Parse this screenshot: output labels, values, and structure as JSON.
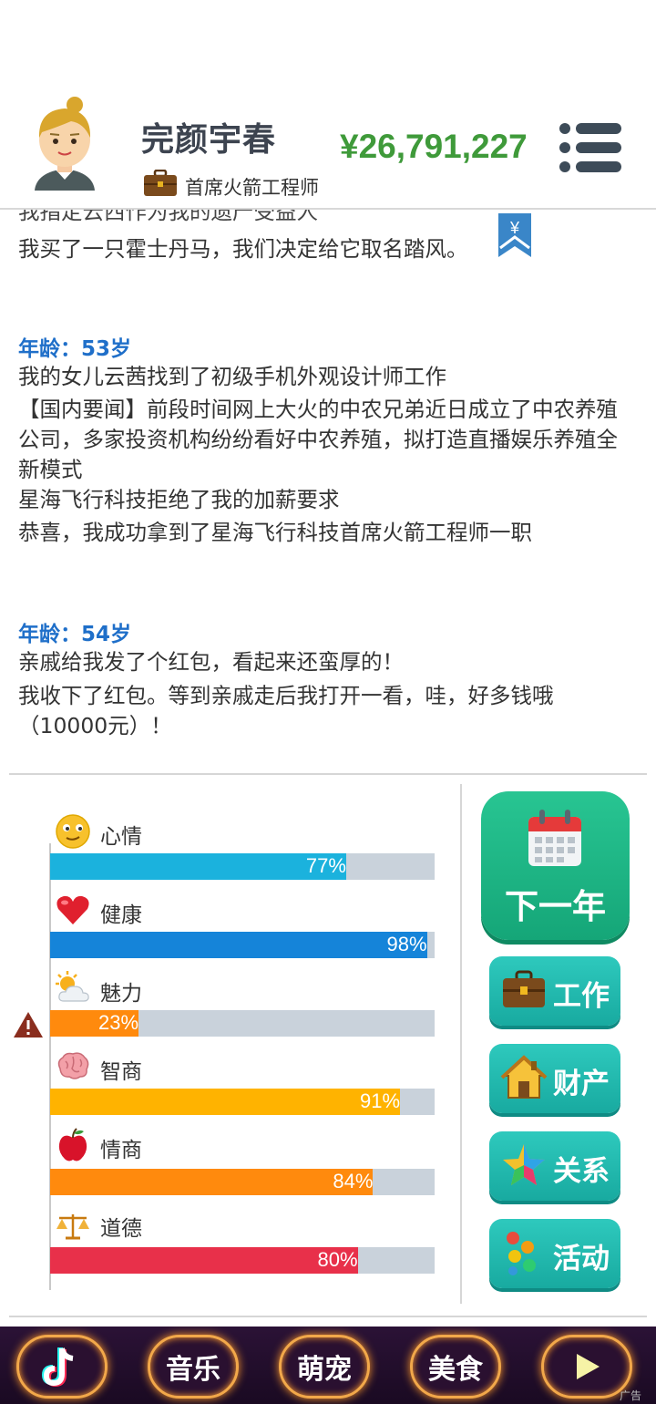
{
  "header": {
    "player_name": "完颜宇春",
    "job_title": "首席火箭工程师",
    "money": "¥26,791,227"
  },
  "log": {
    "partial_line": "我指定云西作为我的遗产受益人",
    "bookmark_symbol": "¥",
    "lines": [
      "我买了一只霍士丹马，我们决定给它取名踏风。"
    ],
    "age_53": "年龄：53岁",
    "entries_53": [
      "我的女儿云茜找到了初级手机外观设计师工作",
      "【国内要闻】前段时间网上大火的中农兄弟近日成立了中农养殖公司，多家投资机构纷纷看好中农养殖，拟打造直播娱乐养殖全新模式",
      "星海飞行科技拒绝了我的加薪要求",
      "恭喜，我成功拿到了星海飞行科技首席火箭工程师一职"
    ],
    "age_54": "年龄：54岁",
    "entries_54": [
      "亲戚给我发了个红包，看起来还蛮厚的！",
      "我收下了红包。等到亲戚走后我打开一看，哇，好多钱哦（10000元）！"
    ]
  },
  "stats": [
    {
      "label": "心情",
      "value": 77,
      "text": "77%",
      "color": "#1bb2dd",
      "icon": "smile-icon"
    },
    {
      "label": "健康",
      "value": 98,
      "text": "98%",
      "color": "#1584d9",
      "icon": "heart-icon"
    },
    {
      "label": "魅力",
      "value": 23,
      "text": "23%",
      "color": "#ff8a0d",
      "icon": "sun-cloud-icon"
    },
    {
      "label": "智商",
      "value": 91,
      "text": "91%",
      "color": "#ffb300",
      "icon": "brain-icon"
    },
    {
      "label": "情商",
      "value": 84,
      "text": "84%",
      "color": "#ff8a0d",
      "icon": "apple-icon"
    },
    {
      "label": "道德",
      "value": 80,
      "text": "80%",
      "color": "#e8304a",
      "icon": "scale-icon"
    }
  ],
  "buttons": {
    "next_year": "下一年",
    "work": "工作",
    "property": "财产",
    "relations": "关系",
    "activity": "活动"
  },
  "bottom_bar": {
    "items": [
      "音乐",
      "萌宠",
      "美食"
    ],
    "ad": "广告"
  }
}
